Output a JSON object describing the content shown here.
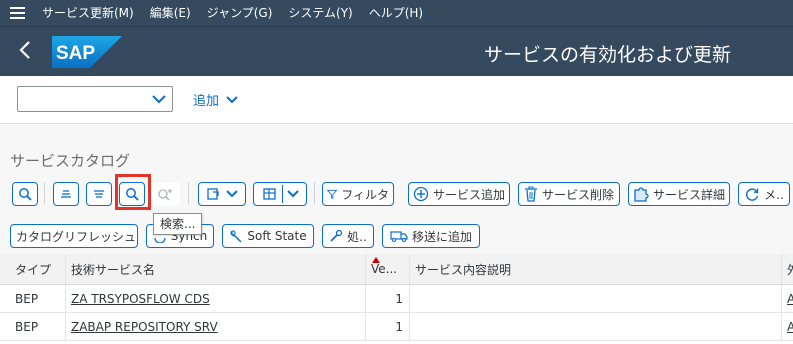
{
  "menu": {
    "items": [
      "サービス更新(M)",
      "編集(E)",
      "ジャンプ(G)",
      "システム(Y)",
      "ヘルプ(H)"
    ]
  },
  "shell": {
    "logo_text": "SAP",
    "title": "サービスの有効化および更新"
  },
  "sub_toolbar": {
    "dropdown_value": "",
    "add_label": "追加"
  },
  "catalog": {
    "title": "サービスカタログ",
    "tooltip": "検索..."
  },
  "toolbar": {
    "filter_label": "フィルタ",
    "add_service_label": "サービス追加",
    "delete_service_label": "サービス削除",
    "service_details_label": "サービス詳細",
    "more_label": "メ..",
    "catalog_refresh_label": "カタログリフレッシュ",
    "synch_label": "Synch",
    "soft_state_label": "Soft State",
    "process_label": "処..",
    "add_to_transport_label": "移送に追加"
  },
  "table": {
    "headers": [
      "タイプ",
      "技術サービス名",
      "Ve...",
      "サービス内容説明",
      "外"
    ],
    "rows": [
      {
        "type": "BEP",
        "name": "ZA TRSYPOSFLOW CDS",
        "version": "1",
        "desc": "",
        "ext": "A"
      },
      {
        "type": "BEP",
        "name": "ZABAP REPOSITORY SRV",
        "version": "1",
        "desc": "",
        "ext": "A"
      }
    ]
  },
  "colors": {
    "shell_bg": "#354a5f",
    "accent": "#0a6ed1",
    "highlight": "#e0352b"
  }
}
